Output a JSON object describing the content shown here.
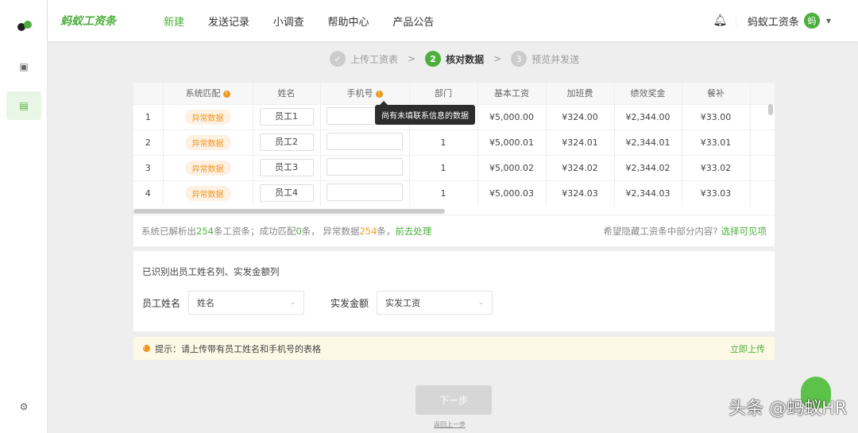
{
  "header": {
    "brand": "蚂蚁工资条",
    "nav": [
      "新建",
      "发送记录",
      "小调查",
      "帮助中心",
      "产品公告"
    ],
    "user": "蚂蚁工资条",
    "avatar": "蚂"
  },
  "steps": [
    {
      "num": "✓",
      "label": "上传工资表"
    },
    {
      "num": "2",
      "label": "核对数据"
    },
    {
      "num": "3",
      "label": "预览并发送"
    }
  ],
  "table": {
    "columns": [
      "",
      "系统匹配",
      "姓名",
      "手机号",
      "部门",
      "基本工资",
      "加班费",
      "绩效奖金",
      "餐补",
      ""
    ],
    "rows": [
      {
        "idx": "1",
        "status": "异常数据",
        "name": "员工1",
        "phone": "",
        "dept": "",
        "base": "¥5,000.00",
        "ot": "¥324.00",
        "perf": "¥2,344.00",
        "meal": "¥33.00"
      },
      {
        "idx": "2",
        "status": "异常数据",
        "name": "员工2",
        "phone": "",
        "dept": "1",
        "base": "¥5,000.01",
        "ot": "¥324.01",
        "perf": "¥2,344.01",
        "meal": "¥33.01"
      },
      {
        "idx": "3",
        "status": "异常数据",
        "name": "员工3",
        "phone": "",
        "dept": "1",
        "base": "¥5,000.02",
        "ot": "¥324.02",
        "perf": "¥2,344.02",
        "meal": "¥33.02"
      },
      {
        "idx": "4",
        "status": "异常数据",
        "name": "员工4",
        "phone": "",
        "dept": "1",
        "base": "¥5,000.03",
        "ot": "¥324.03",
        "perf": "¥2,344.03",
        "meal": "¥33.03"
      }
    ],
    "tooltip": "尚有未填联系信息的数据"
  },
  "summary": {
    "p1": "系统已解析出",
    "total": "254",
    "p2": "条工资条；成功匹配",
    "matched": "0",
    "p3": "条，  异常数据",
    "abnormal": "254",
    "p4": "条，",
    "action": "前去处理",
    "hide_q": "希望隐藏工资条中部分内容?",
    "hide_link": "选择可见项"
  },
  "mapping": {
    "title": "已识别出员工姓名列、实发金额列",
    "name_label": "员工姓名",
    "name_value": "姓名",
    "amount_label": "实发金额",
    "amount_value": "实发工资"
  },
  "tip": {
    "text": "提示：请上传带有员工姓名和手机号的表格",
    "link": "立即上传"
  },
  "footer": {
    "next": "下一步",
    "back": "返回上一步"
  },
  "watermark": "头条 @蚂蚁HR"
}
